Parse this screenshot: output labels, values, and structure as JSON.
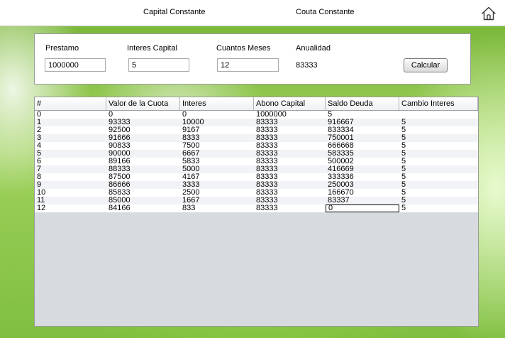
{
  "tabs": {
    "capital_constante": "Capital Constante",
    "couta_constante": "Couta Constante"
  },
  "home_icon": "home-icon",
  "form": {
    "prestamo_label": "Prestamo",
    "prestamo_value": "1000000",
    "interes_label": "Interes Capital",
    "interes_value": "5",
    "meses_label": "Cuantos Meses",
    "meses_value": "12",
    "anualidad_label": "Anualidad",
    "anualidad_value": "83333",
    "calcular_label": "Calcular"
  },
  "table": {
    "headers": [
      "#",
      "Valor de la Cuota",
      "Interes",
      "Abono Capital",
      "Saldo Deuda",
      "Cambio Interes"
    ],
    "rows": [
      [
        "0",
        "0",
        "0",
        "1000000",
        "5",
        ""
      ],
      [
        "1",
        "93333",
        "10000",
        "83333",
        "916667",
        "5"
      ],
      [
        "2",
        "92500",
        "9167",
        "83333",
        "833334",
        "5"
      ],
      [
        "3",
        "91666",
        "8333",
        "83333",
        "750001",
        "5"
      ],
      [
        "4",
        "90833",
        "7500",
        "83333",
        "666668",
        "5"
      ],
      [
        "5",
        "90000",
        "6667",
        "83333",
        "583335",
        "5"
      ],
      [
        "6",
        "89166",
        "5833",
        "83333",
        "500002",
        "5"
      ],
      [
        "7",
        "88333",
        "5000",
        "83333",
        "416669",
        "5"
      ],
      [
        "8",
        "87500",
        "4167",
        "83333",
        "333336",
        "5"
      ],
      [
        "9",
        "86666",
        "3333",
        "83333",
        "250003",
        "5"
      ],
      [
        "10",
        "85833",
        "2500",
        "83333",
        "166670",
        "5"
      ],
      [
        "11",
        "85000",
        "1667",
        "83333",
        "83337",
        "5"
      ],
      [
        "12",
        "84166",
        "833",
        "83333",
        "0",
        "5"
      ]
    ]
  }
}
